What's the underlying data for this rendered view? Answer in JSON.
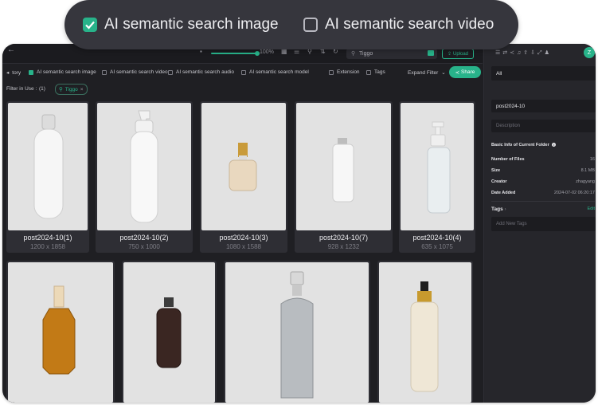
{
  "pill": {
    "options": [
      {
        "label": "AI semantic search image",
        "checked": true
      },
      {
        "label": "AI semantic search video",
        "checked": false
      }
    ]
  },
  "topbar": {
    "zoom": "100%",
    "search_value": "Tiggo",
    "upload_label": "Upload"
  },
  "filters": {
    "history_label": "tory",
    "items": [
      {
        "label": "AI semantic search image",
        "checked": true
      },
      {
        "label": "AI semantic search video",
        "checked": false
      },
      {
        "label": "AI semantic search audio",
        "checked": false
      },
      {
        "label": "AI semantic search model",
        "checked": false
      },
      {
        "label": "Extension",
        "checked": false
      },
      {
        "label": "Tags",
        "checked": false
      }
    ],
    "expand_label": "Expand Filter",
    "share_label": "Share",
    "in_use_label": "Filter in Use :",
    "in_use_count": "(1)",
    "chip_label": "Tiggo"
  },
  "files": [
    {
      "name": "post2024-10(1)",
      "dims": "1200 x 1858"
    },
    {
      "name": "post2024-10(2)",
      "dims": "750 x 1000"
    },
    {
      "name": "post2024-10(3)",
      "dims": "1080 x 1588"
    },
    {
      "name": "post2024-10(7)",
      "dims": "928 x 1232"
    },
    {
      "name": "post2024-10(4)",
      "dims": "635 x 1075"
    }
  ],
  "panel": {
    "scope": "All",
    "folder_name": "post2024-10",
    "description_placeholder": "Description",
    "basic_info_title": "Basic Info of Current Folder",
    "info": [
      {
        "key": "Number of Files",
        "value": "16"
      },
      {
        "key": "Size",
        "value": "8.1 MB"
      },
      {
        "key": "Creator",
        "value": "zhagyang"
      },
      {
        "key": "Date Added",
        "value": "2024-07-02 06:20:17"
      }
    ],
    "tags_label": "Tags",
    "edit_label": "Edit",
    "add_tag_placeholder": "Add New Tags",
    "avatar_letter": "Z"
  },
  "colors": {
    "accent": "#28b38a",
    "bg": "#1f1f23",
    "card": "#2e2e34"
  }
}
